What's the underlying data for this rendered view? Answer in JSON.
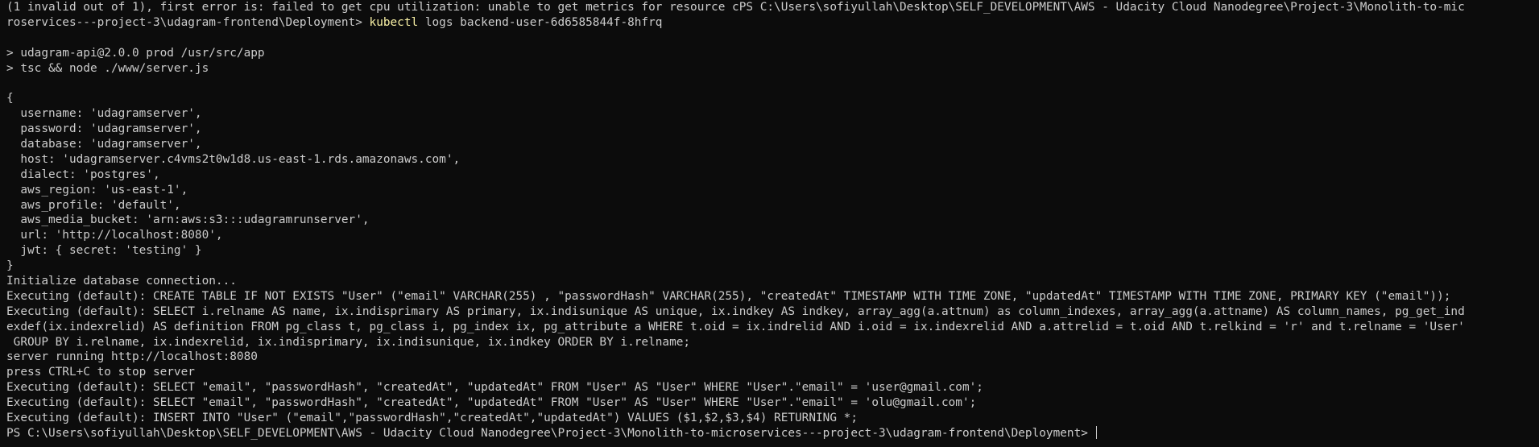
{
  "terminal": {
    "colors": {
      "background": "#0c0c0c",
      "text": "#cccccc",
      "command": "#f9f1a5"
    },
    "top_lines": [
      "(1 invalid out of 1), first error is: failed to get cpu utilization: unable to get metrics for resource cPS C:\\Users\\sofiyullah\\Desktop\\SELF_DEVELOPMENT\\AWS - Udacity Cloud Nanodegree\\Project-3\\Monolith-to-mic"
    ],
    "command_line": {
      "prompt": "roservices---project-3\\udagram-frontend\\Deployment> ",
      "command": "kubectl",
      "args": " logs backend-user-6d6585844f-8hfrq"
    },
    "output_lines": [
      "",
      "> udagram-api@2.0.0 prod /usr/src/app",
      "> tsc && node ./www/server.js",
      "",
      "{",
      "  username: 'udagramserver',",
      "  password: 'udagramserver',",
      "  database: 'udagramserver',",
      "  host: 'udagramserver.c4vms2t0w1d8.us-east-1.rds.amazonaws.com',",
      "  dialect: 'postgres',",
      "  aws_region: 'us-east-1',",
      "  aws_profile: 'default',",
      "  aws_media_bucket: 'arn:aws:s3:::udagramrunserver',",
      "  url: 'http://localhost:8080',",
      "  jwt: { secret: 'testing' }",
      "}",
      "Initialize database connection...",
      "Executing (default): CREATE TABLE IF NOT EXISTS \"User\" (\"email\" VARCHAR(255) , \"passwordHash\" VARCHAR(255), \"createdAt\" TIMESTAMP WITH TIME ZONE, \"updatedAt\" TIMESTAMP WITH TIME ZONE, PRIMARY KEY (\"email\"));",
      "Executing (default): SELECT i.relname AS name, ix.indisprimary AS primary, ix.indisunique AS unique, ix.indkey AS indkey, array_agg(a.attnum) as column_indexes, array_agg(a.attname) AS column_names, pg_get_ind",
      "exdef(ix.indexrelid) AS definition FROM pg_class t, pg_class i, pg_index ix, pg_attribute a WHERE t.oid = ix.indrelid AND i.oid = ix.indexrelid AND a.attrelid = t.oid AND t.relkind = 'r' and t.relname = 'User'",
      " GROUP BY i.relname, ix.indexrelid, ix.indisprimary, ix.indisunique, ix.indkey ORDER BY i.relname;",
      "server running http://localhost:8080",
      "press CTRL+C to stop server",
      "Executing (default): SELECT \"email\", \"passwordHash\", \"createdAt\", \"updatedAt\" FROM \"User\" AS \"User\" WHERE \"User\".\"email\" = 'user@gmail.com';",
      "Executing (default): SELECT \"email\", \"passwordHash\", \"createdAt\", \"updatedAt\" FROM \"User\" AS \"User\" WHERE \"User\".\"email\" = 'olu@gmail.com';",
      "Executing (default): INSERT INTO \"User\" (\"email\",\"passwordHash\",\"createdAt\",\"updatedAt\") VALUES ($1,$2,$3,$4) RETURNING *;"
    ],
    "final_prompt": "PS C:\\Users\\sofiyullah\\Desktop\\SELF_DEVELOPMENT\\AWS - Udacity Cloud Nanodegree\\Project-3\\Monolith-to-microservices---project-3\\udagram-frontend\\Deployment> "
  }
}
